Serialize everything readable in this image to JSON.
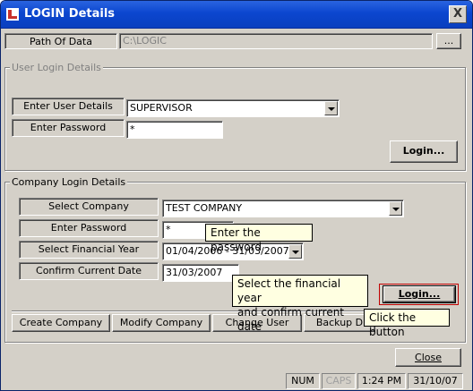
{
  "window": {
    "title": "LOGIN Details",
    "close_glyph": "X"
  },
  "path": {
    "label": "Path Of Data",
    "value": "C:\\LOGIC",
    "browse_label": "..."
  },
  "user_login": {
    "group_title": "User Login Details",
    "user_label": "Enter User Details",
    "user_value": "SUPERVISOR",
    "password_label": "Enter Password",
    "password_value": "*",
    "login_label": "Login..."
  },
  "company_login": {
    "group_title": "Company Login Details",
    "company_label": "Select Company",
    "company_value": "TEST COMPANY",
    "password_label": "Enter Password",
    "password_value": "*",
    "year_label": "Select Financial Year",
    "year_value": "01/04/2006 - 31/03/2007",
    "date_label": "Confirm Current Date",
    "date_value": "31/03/2007",
    "login_label": "Login..."
  },
  "tooltips": {
    "password": "Enter the password",
    "year_line1": "Select the financial year",
    "year_line2": "and confirm current date",
    "button": "Click the button"
  },
  "actions": {
    "create_company": "Create Company",
    "modify_company": "Modify Company",
    "change_user": "Change User",
    "backup": "Backup D"
  },
  "close_label": "Close",
  "statusbar": {
    "num": "NUM",
    "caps": "CAPS",
    "time": "1:24 PM",
    "date": "31/10/07"
  },
  "colors": {
    "titlebar": "#0b46cf",
    "dialog": "#d4d0c8",
    "tooltip": "#ffffe1",
    "highlight": "#c00000"
  }
}
